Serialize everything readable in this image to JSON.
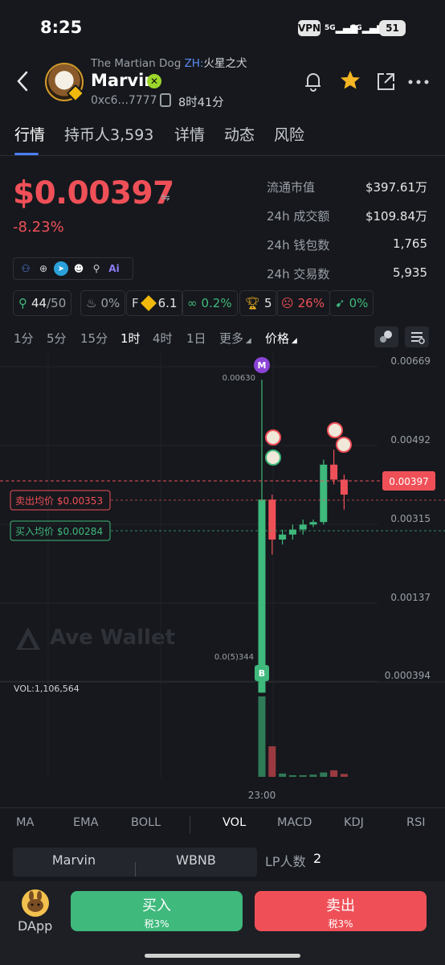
{
  "status_bar": {
    "time": "8:25",
    "vpn": "VPN",
    "signal1": "5G",
    "signal2": "5G",
    "battery": "51"
  },
  "header": {
    "subtitle_en": "The Martian Dog",
    "subtitle_zh_tag": "ZH:",
    "subtitle_zh_name": "火星之犬",
    "token_name": "Marvin",
    "address": "0xc6...7777",
    "age": "8时41分"
  },
  "tabs": [
    "行情",
    "持币人3,593",
    "详情",
    "动态",
    "风险"
  ],
  "price": {
    "value": "$0.00397",
    "change": "-8.23%",
    "stats": [
      {
        "label": "流通市值",
        "value": "$397.61万"
      },
      {
        "label": "24h 成交额",
        "value": "$109.84万"
      },
      {
        "label": "24h 钱包数",
        "value": "1,765"
      },
      {
        "label": "24h 交易数",
        "value": "5,935"
      }
    ]
  },
  "chips": [
    {
      "icon": "holders-icon",
      "value": "44",
      "suffix": "/50",
      "color": "#3fb97c"
    },
    {
      "icon": "chef-icon",
      "value": "0%",
      "color": "#9aa0a8"
    },
    {
      "icon": "bnb-score-icon",
      "prefix": "F",
      "value": "6.1",
      "color": "#e6e6e6"
    },
    {
      "icon": "link-icon",
      "value": "0.2%",
      "color": "#3fb97c"
    },
    {
      "icon": "trophy-icon",
      "value": "5",
      "color": "#e6e6e6"
    },
    {
      "icon": "alien-icon",
      "value": "26%",
      "color": "#ef5058"
    },
    {
      "icon": "rocket-icon",
      "value": "0%",
      "color": "#3fb97c"
    }
  ],
  "intervals": [
    "1分",
    "5分",
    "15分",
    "1时",
    "4时",
    "1日",
    "更多",
    "价格"
  ],
  "active_interval": "1时",
  "chart_data": {
    "type": "candlestick",
    "y_axis_labels": [
      "0.00669",
      "0.00492",
      "0.00315",
      "0.00137",
      "0.000394"
    ],
    "high_label": "0.00630",
    "low_label": "0.0(5)344",
    "current_price_label": "0.00397",
    "sell_avg_label": "卖出均价 $0.00353",
    "buy_avg_label": "买入均价 $0.00284",
    "x_label": "23:00",
    "vol_label": "VOL:1,106,564",
    "marker_top": "M",
    "marker_bottom": "B",
    "watermark": "Ave Wallet",
    "candles": [
      {
        "o": 3.44e-05,
        "h": 0.0063,
        "l": 3.44e-05,
        "c": 0.0039,
        "dir": "up"
      },
      {
        "o": 0.0039,
        "h": 0.004,
        "l": 0.0028,
        "c": 0.0031,
        "dir": "down"
      },
      {
        "o": 0.0031,
        "h": 0.0033,
        "l": 0.003,
        "c": 0.0032,
        "dir": "up"
      },
      {
        "o": 0.0032,
        "h": 0.0034,
        "l": 0.0031,
        "c": 0.0033,
        "dir": "up"
      },
      {
        "o": 0.0033,
        "h": 0.0035,
        "l": 0.0032,
        "c": 0.0034,
        "dir": "up"
      },
      {
        "o": 0.0034,
        "h": 0.0035,
        "l": 0.00335,
        "c": 0.00345,
        "dir": "up"
      },
      {
        "o": 0.00345,
        "h": 0.0047,
        "l": 0.0034,
        "c": 0.0046,
        "dir": "up"
      },
      {
        "o": 0.0046,
        "h": 0.0049,
        "l": 0.0042,
        "c": 0.0043,
        "dir": "down"
      },
      {
        "o": 0.0043,
        "h": 0.0044,
        "l": 0.0037,
        "c": 0.004,
        "dir": "down"
      }
    ],
    "volumes": [
      1106564,
      420000,
      45000,
      20000,
      15000,
      30000,
      60000,
      90000,
      40000
    ]
  },
  "indicators": [
    "MA",
    "EMA",
    "BOLL",
    "VOL",
    "MACD",
    "KDJ",
    "RSI"
  ],
  "active_indicator": "VOL",
  "lp": {
    "tab_a": "Marvin",
    "tab_b": "WBNB",
    "count_label": "LP人数",
    "count": "2"
  },
  "bottom": {
    "dapp_label": "DApp",
    "buy_label": "买入",
    "buy_tax": "税3%",
    "sell_label": "卖出",
    "sell_tax": "税3%"
  }
}
